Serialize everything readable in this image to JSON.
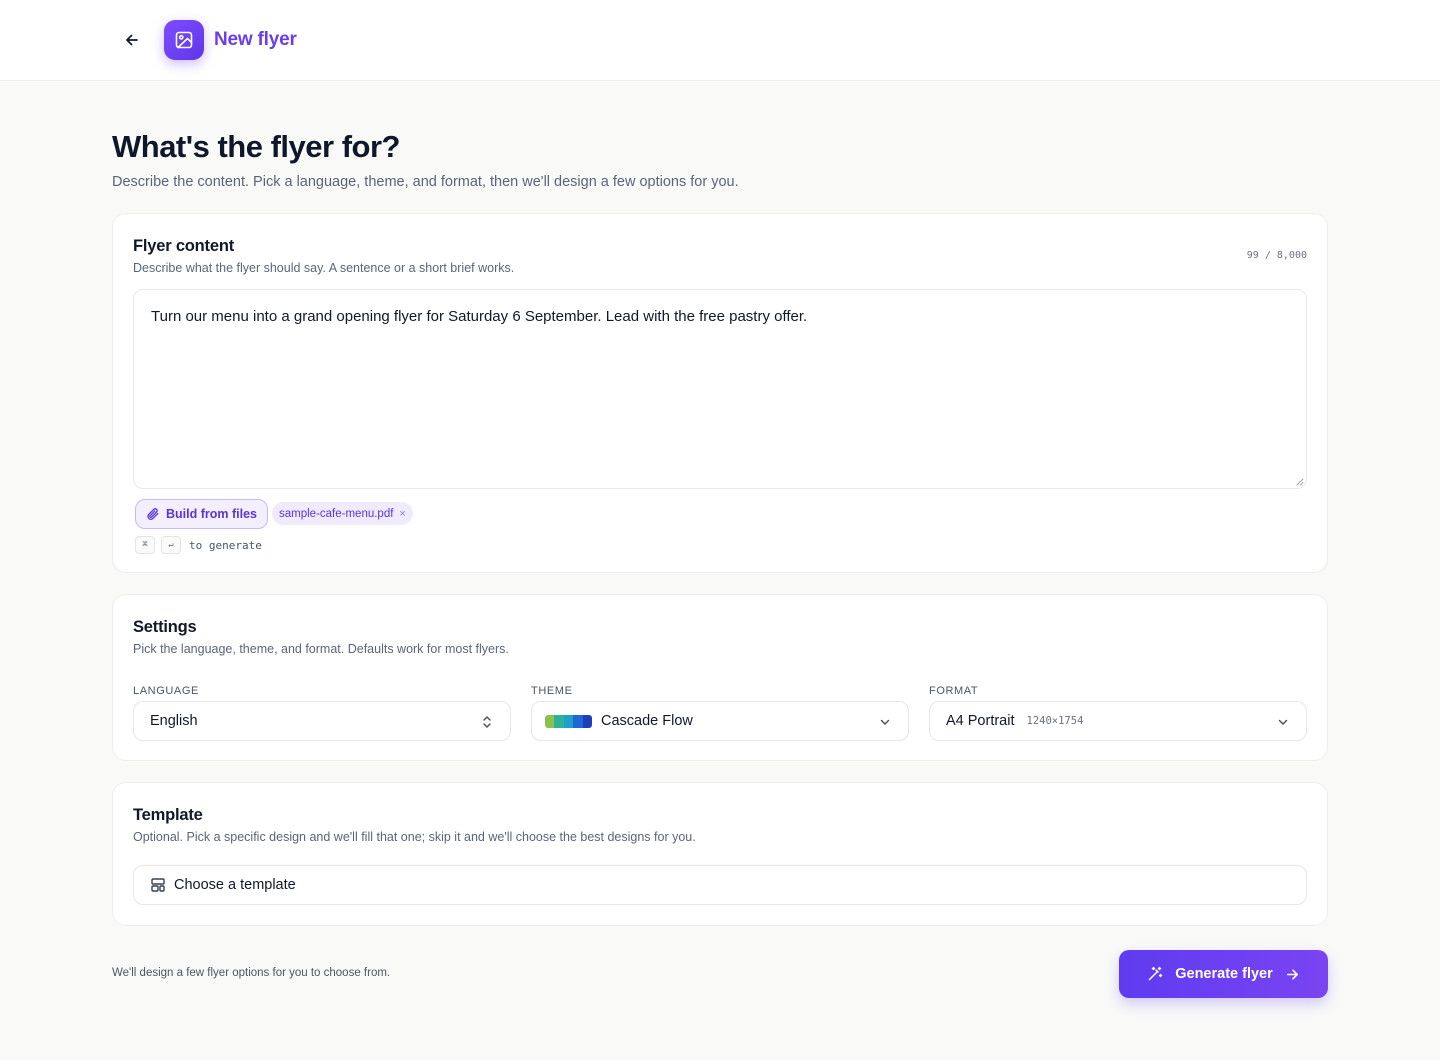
{
  "header": {
    "back_icon": "arrow-left-icon",
    "logo_icon": "image-icon",
    "title": "New flyer",
    "accent_color": "#6a3df0"
  },
  "page": {
    "title": "What's the flyer for?",
    "subtitle": "Describe the content. Pick a language, theme, and format, then we'll design a few options for you."
  },
  "content_card": {
    "title": "Flyer content",
    "description": "Describe what the flyer should say. A sentence or a short brief works.",
    "counter": "99 / 8,000",
    "textarea_value": "Turn our menu into a grand opening flyer for Saturday 6 September. Lead with the free pastry offer.",
    "build_button_label": "Build from files",
    "build_button_icon": "paperclip-icon",
    "attached_file": "sample-cafe-menu.pdf",
    "remove_file_glyph": "×",
    "shortcut_keys": [
      "⌘",
      "↵"
    ],
    "shortcut_hint": "to generate"
  },
  "settings_card": {
    "title": "Settings",
    "description": "Pick the language, theme, and format. Defaults work for most flyers.",
    "language": {
      "label": "Language",
      "value": "English",
      "icon": "chevron-up-down-icon"
    },
    "theme": {
      "label": "Theme",
      "value": "Cascade Flow",
      "swatch_colors": [
        "#8bc34a",
        "#2bb39a",
        "#1ea0c8",
        "#2166d6",
        "#1d3fb8"
      ],
      "icon": "chevron-down-icon"
    },
    "format": {
      "label": "Format",
      "value": "A4 Portrait",
      "dimensions": "1240×1754",
      "icon": "chevron-down-icon"
    }
  },
  "template_card": {
    "title": "Template",
    "description": "Optional. Pick a specific design and we'll fill that one; skip it and we'll choose the best designs for you.",
    "button_label": "Choose a template",
    "button_icon": "layout-template-icon"
  },
  "footer": {
    "note": "We'll design a few flyer options for you to choose from.",
    "generate_label": "Generate flyer",
    "generate_icon": "magic-wand-icon",
    "generate_arrow_icon": "arrow-right-icon"
  }
}
